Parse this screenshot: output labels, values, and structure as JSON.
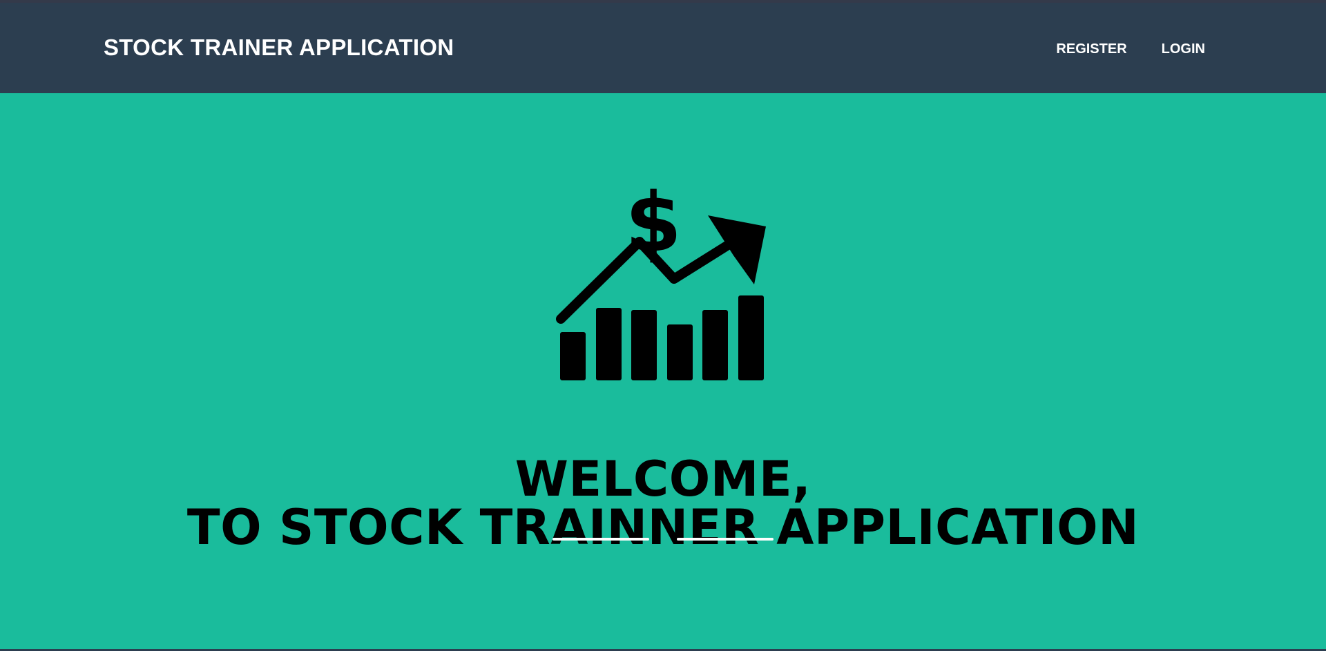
{
  "navbar": {
    "brand": "STOCK TRAINER APPLICATION",
    "links": [
      {
        "label": "REGISTER"
      },
      {
        "label": "LOGIN"
      }
    ]
  },
  "hero": {
    "icon": "stock-growth-dollar-icon",
    "heading_line1": "WELCOME,",
    "heading_line2": "TO STOCK TRAINNER APPLICATION"
  },
  "colors": {
    "navbar_bg": "#2c3e50",
    "hero_bg": "#1abc9c",
    "text_dark": "#000000",
    "text_light": "#ffffff"
  }
}
